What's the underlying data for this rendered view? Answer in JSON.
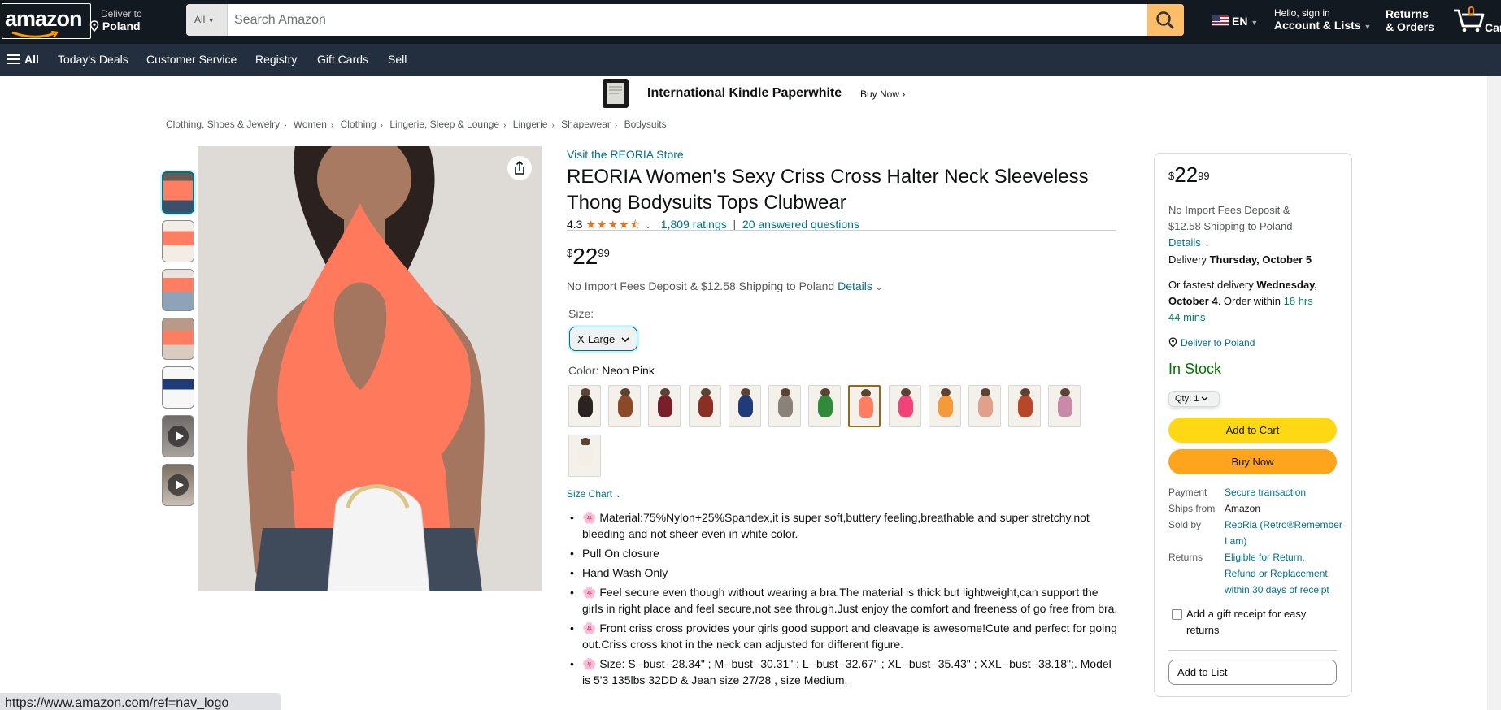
{
  "header": {
    "logo_text": "amazon",
    "deliver_to_label": "Deliver to",
    "deliver_to_location": "Poland",
    "search_category": "All",
    "search_placeholder": "Search Amazon",
    "language": "EN",
    "account_greeting": "Hello, sign in",
    "account_label": "Account & Lists",
    "returns_label": "Returns",
    "orders_label": "& Orders",
    "cart_count": "0",
    "cart_label": "Cart"
  },
  "nav": {
    "all_label": "All",
    "items": [
      "Today's Deals",
      "Customer Service",
      "Registry",
      "Gift Cards",
      "Sell"
    ]
  },
  "promo": {
    "title": "International Kindle Paperwhite",
    "cta": "Buy Now ›"
  },
  "breadcrumbs": [
    "Clothing, Shoes & Jewelry",
    "Women",
    "Clothing",
    "Lingerie, Sleep & Lounge",
    "Lingerie",
    "Shapewear",
    "Bodysuits"
  ],
  "product": {
    "store_link": "Visit the REORIA Store",
    "title": "REORIA Women's Sexy Criss Cross Halter Neck Sleeveless Thong Bodysuits Tops Clubwear",
    "rating_value": "4.3",
    "rating_stars": "★★★★⯪",
    "ratings_count": "1,809 ratings",
    "questions": "20 answered questions",
    "price_currency": "$",
    "price_whole": "22",
    "price_fraction": "99",
    "fees_text": "No Import Fees Deposit & $12.58 Shipping to Poland",
    "details_link": "Details",
    "size_label": "Size:",
    "size_selected": "X-Large",
    "color_label": "Color:",
    "color_selected": "Neon Pink",
    "swatch_colors": [
      "#2a2320",
      "#8a4a2a",
      "#7a1f2a",
      "#8b2f25",
      "#1f3b7a",
      "#8a8278",
      "#2f8a3a",
      "#ff7e62",
      "#f2427a",
      "#f59a3a",
      "#e0a08a",
      "#b8472a",
      "#c88aa8",
      "#f4efe6"
    ],
    "size_chart_link": "Size Chart",
    "bullets": [
      "🌸 Material:75%Nylon+25%Spandex,it is super soft,buttery feeling,breathable and super stretchy,not bleeding and not sheer even in white color.",
      "Pull On closure",
      "Hand Wash Only",
      "🌸 Feel secure even though without wearing a bra.The material is thick but lightweight,can support the girls in right place and feel secure,not see through.Just enjoy the comfort and freeness of go free from bra.",
      "🌸 Front criss cross provides your girls good support and cleavage is awesome!Cute and perfect for going out.Criss cross knot in the neck can adjusted for different figure.",
      "🌸 Size: S--bust--28.34\" ; M--bust--30.31\" ; L--bust--32.67\" ; XL--bust--35.43\" ; XXL--bust--38.18\";. Model is 5'3 135lbs 32DD & Jean size 27/28 , size Medium."
    ]
  },
  "buybox": {
    "price_currency": "$",
    "price_whole": "22",
    "price_fraction": "99",
    "fees_line1": "No Import Fees Deposit &",
    "fees_line2": "$12.58 Shipping to Poland",
    "details_link": "Details",
    "delivery_prefix": "Delivery",
    "delivery_date": "Thursday, October 5",
    "fastest_prefix": "Or fastest delivery",
    "fastest_date_1": "Wednesday,",
    "fastest_date_2": "October 4",
    "order_within": ". Order within",
    "countdown_1": "18 hrs",
    "countdown_2": "44 mins",
    "deliver_to": "Deliver to Poland",
    "stock": "In Stock",
    "qty_label": "Qty: 1",
    "add_to_cart": "Add to Cart",
    "buy_now": "Buy Now",
    "payment_label": "Payment",
    "payment_value": "Secure transaction",
    "ships_from_label": "Ships from",
    "ships_from_value": "Amazon",
    "sold_by_label": "Sold by",
    "sold_by_value_1": "ReoRia (Retro®Remember",
    "sold_by_value_2": "I am)",
    "returns_label": "Returns",
    "returns_value_1": "Eligible for Return,",
    "returns_value_2": "Refund or Replacement",
    "returns_value_3": "within 30 days of receipt",
    "gift_receipt_1": "Add a gift receipt for easy",
    "gift_receipt_2": "returns",
    "add_to_list": "Add to List"
  },
  "status_url": "https://www.amazon.com/ref=nav_logo"
}
